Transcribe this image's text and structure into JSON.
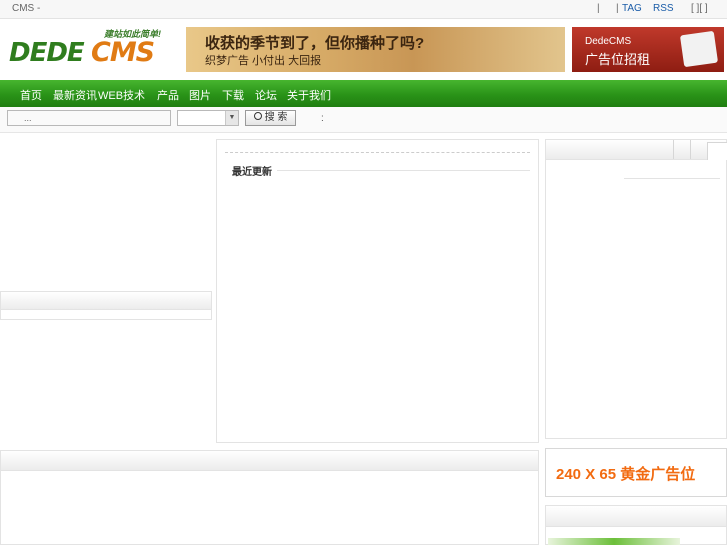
{
  "topbar": {
    "site_title": "CMS -",
    "sep1": "|",
    "sep2": "|",
    "tag_link": "TAG",
    "rss_link": "RSS",
    "brackets": "[  ][  ]"
  },
  "logo": {
    "slogan": "建站如此简单!",
    "brand_left": "DEDE",
    "brand_right": "CMS"
  },
  "banner_main": {
    "headline": "收获的季节到了，但你播种了吗?",
    "subline": "织梦广告  小付出  大回报"
  },
  "banner_side": {
    "brand": "DedeCMS",
    "text": "广告位招租"
  },
  "nav": {
    "items": [
      "首页",
      "最新资讯",
      "WEB技术",
      "产品",
      "图片",
      "下载",
      "论坛",
      "关于我们"
    ]
  },
  "search": {
    "placeholder": "...",
    "button_label": "搜 索",
    "colon": ":"
  },
  "main": {
    "recent_label": "最近更新"
  },
  "ads": {
    "gold_text": "240 X 65 黄金广告位"
  },
  "colors": {
    "nav_green": "#2a9318",
    "link_blue": "#1a5ca8",
    "ad_orange": "#f26b11",
    "logo_green": "#2f7d1e",
    "logo_orange": "#e07b14"
  }
}
